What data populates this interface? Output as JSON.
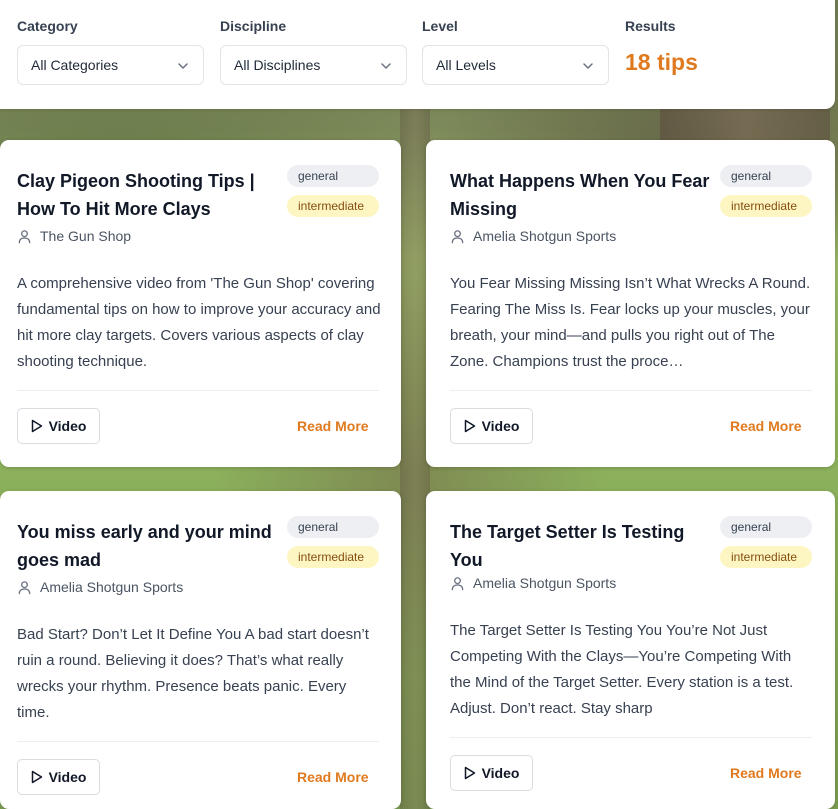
{
  "filters": {
    "category": {
      "label": "Category",
      "value": "All Categories"
    },
    "discipline": {
      "label": "Discipline",
      "value": "All Disciplines"
    },
    "level": {
      "label": "Level",
      "value": "All Levels"
    },
    "results": {
      "label": "Results",
      "value": "18 tips"
    }
  },
  "cards": [
    {
      "title": "Clay Pigeon Shooting Tips | How To Hit More Clays",
      "category": "general",
      "level": "intermediate",
      "author": "The Gun Shop",
      "description": "A comprehensive video from 'The Gun Shop' covering fundamental tips on how to improve your accuracy and hit more clay targets. Covers various aspects of clay shooting technique.",
      "video_label": "Video",
      "read_more_label": "Read More"
    },
    {
      "title": "What Happens When You Fear Missing",
      "category": "general",
      "level": "intermediate",
      "author": "Amelia Shotgun Sports",
      "description": "You Fear Missing Missing Isn’t What Wrecks A Round. Fearing The Miss Is. Fear locks up your muscles, your breath, your mind—and pulls you right out of The Zone. Champions trust the proce…",
      "video_label": "Video",
      "read_more_label": "Read More"
    },
    {
      "title": "You miss early and your mind goes mad",
      "category": "general",
      "level": "intermediate",
      "author": "Amelia Shotgun Sports",
      "description": "Bad Start? Don’t Let It Define You A bad start doesn’t ruin a round. Believing it does? That’s what really wrecks your rhythm. Presence beats panic. Every time.",
      "video_label": "Video",
      "read_more_label": "Read More"
    },
    {
      "title": "The Target Setter Is Testing You",
      "category": "general",
      "level": "intermediate",
      "author": "Amelia Shotgun Sports",
      "description": "The Target Setter Is Testing You You’re Not Just Competing With the Clays—You’re Competing With the Mind of the Target Setter. Every station is a test. Adjust. Don’t react. Stay sharp",
      "video_label": "Video",
      "read_more_label": "Read More"
    }
  ],
  "colors": {
    "accent": "#e07a1f",
    "level_badge": "#fdf6c3",
    "category_badge": "#eeeff2"
  }
}
